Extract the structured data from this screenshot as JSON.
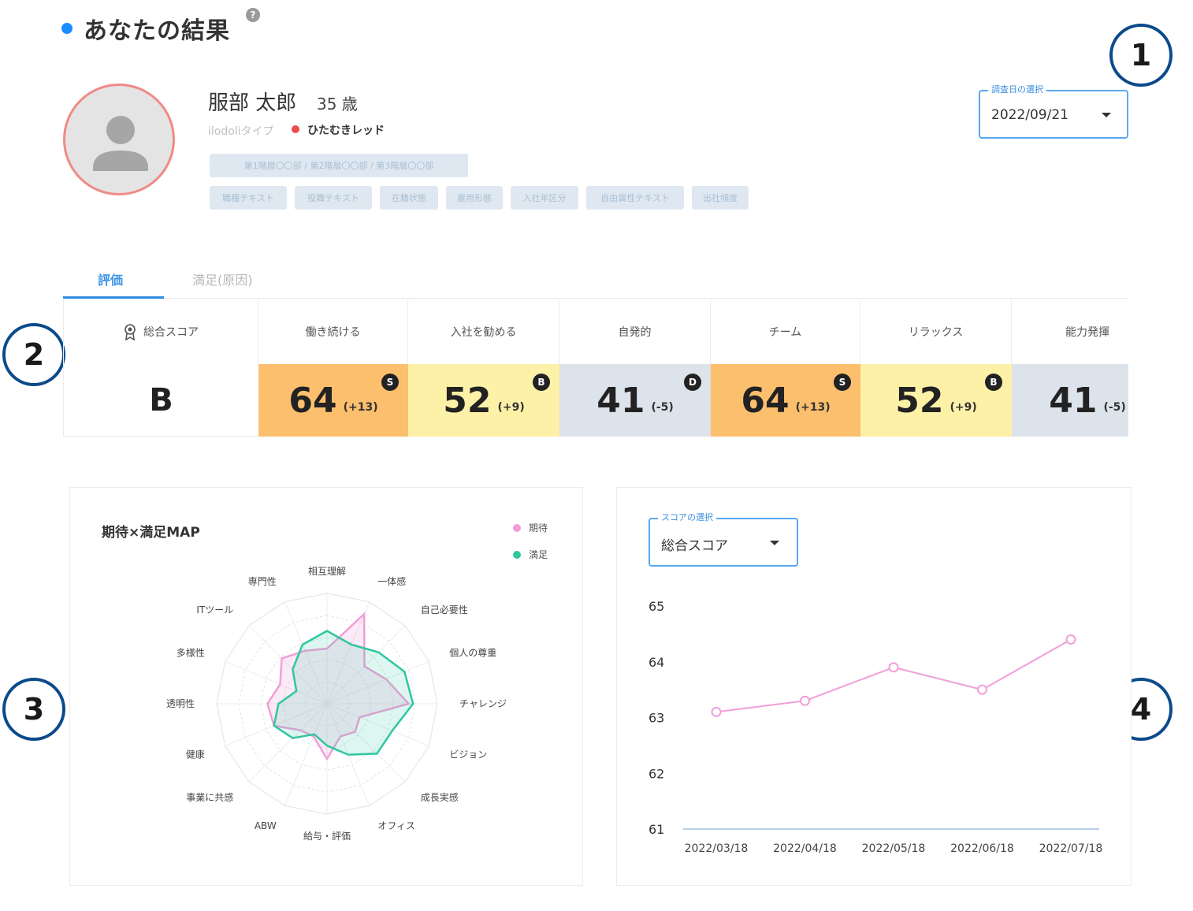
{
  "header": {
    "title": "あなたの結果",
    "help_icon": "question-circle-icon"
  },
  "callouts": [
    "1",
    "2",
    "3",
    "4"
  ],
  "profile": {
    "avatar_icon": "person-icon",
    "name": "服部 太郎",
    "age": "35 歳",
    "type_label": "ilodoliタイプ",
    "type_value": "ひたむきレッド",
    "type_color": "#f04a4a",
    "dept_path": "第1階層〇〇部 / 第2階層〇〇部 / 第3階層〇〇部",
    "tags": [
      "職種テキスト",
      "役職テキスト",
      "在籍状態",
      "雇用形態",
      "入社年区分",
      "自由属性テキスト",
      "出社頻度"
    ]
  },
  "date_select": {
    "legend": "調査日の選択",
    "value": "2022/09/21"
  },
  "tabs": [
    {
      "label": "評価",
      "active": true
    },
    {
      "label": "満足(原因)",
      "active": false
    }
  ],
  "scores": {
    "total": {
      "label": "総合スコア",
      "grade": "B",
      "icon": "award-icon"
    },
    "items": [
      {
        "label": "働き続ける",
        "value": "64",
        "diff": "(+13)",
        "grade": "S",
        "color": "#fbbf6e"
      },
      {
        "label": "入社を勧める",
        "value": "52",
        "diff": "(+9)",
        "grade": "B",
        "color": "#fdf1a8"
      },
      {
        "label": "自発的",
        "value": "41",
        "diff": "(-5)",
        "grade": "D",
        "color": "#dde3ea"
      },
      {
        "label": "チーム",
        "value": "64",
        "diff": "(+13)",
        "grade": "S",
        "color": "#fbbf6e"
      },
      {
        "label": "リラックス",
        "value": "52",
        "diff": "(+9)",
        "grade": "B",
        "color": "#fdf1a8"
      },
      {
        "label": "能力発揮",
        "value": "41",
        "diff": "(-5)",
        "grade": "",
        "color": "#dde3ea"
      }
    ]
  },
  "radar": {
    "title": "期待×満足MAP",
    "legend": [
      {
        "name": "期待",
        "color": "#f29ed8"
      },
      {
        "name": "満足",
        "color": "#2fc7a0"
      }
    ]
  },
  "score_select": {
    "legend": "スコアの選択",
    "value": "総合スコア"
  },
  "chart_data": [
    {
      "type": "radar",
      "title": "期待×満足MAP",
      "axes": [
        "相互理解",
        "一体感",
        "自己必要性",
        "個人の尊重",
        "チャレンジ",
        "ビジョン",
        "成長実感",
        "オフィス",
        "給与・評価",
        "ABW",
        "事業に共感",
        "健康",
        "透明性",
        "多様性",
        "ITツール",
        "専門性"
      ],
      "range": [
        0,
        5
      ],
      "series": [
        {
          "name": "期待",
          "color": "#f29ed8",
          "values": [
            2.5,
            4.4,
            2.4,
            2.9,
            3.7,
            1.6,
            1.8,
            1.6,
            2.5,
            1.6,
            1.7,
            2.6,
            2.7,
            2.3,
            2.9,
            2.6
          ]
        },
        {
          "name": "満足",
          "color": "#2fc7a0",
          "values": [
            3.3,
            2.9,
            3.3,
            3.8,
            3.9,
            3.2,
            3.2,
            2.5,
            1.9,
            1.5,
            2.2,
            2.6,
            2.2,
            1.5,
            2.2,
            2.9
          ]
        }
      ]
    },
    {
      "type": "line",
      "title": "",
      "categories": [
        "2022/03/18",
        "2022/04/18",
        "2022/05/18",
        "2022/06/18",
        "2022/07/18"
      ],
      "series": [
        {
          "name": "",
          "color": "#f29ed8",
          "values": [
            63.1,
            63.3,
            63.9,
            63.5,
            64.4
          ]
        }
      ],
      "yticks": [
        65,
        64,
        63,
        62,
        61
      ],
      "ylim": [
        61,
        65
      ],
      "grid": false
    }
  ]
}
